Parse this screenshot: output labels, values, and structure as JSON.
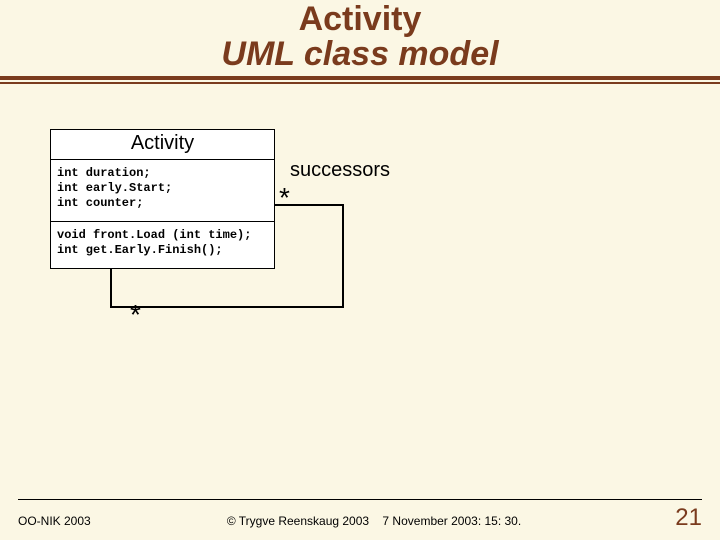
{
  "title": {
    "line1": "Activity",
    "line2": "UML class model"
  },
  "uml": {
    "class_name": "Activity",
    "attributes": "int duration;\nint early.Start;\nint counter;",
    "operations": "void front.Load (int time);\nint get.Early.Finish();",
    "assoc_label": "successors",
    "mult_top": "*",
    "mult_bottom": "*"
  },
  "footer": {
    "left": "OO-NIK 2003",
    "center": "© Trygve Reenskaug 2003",
    "date": "7 November 2003: 15: 30.",
    "slide": "21"
  },
  "colors": {
    "bg": "#fbf7e4",
    "accent": "#7a3b1d"
  }
}
